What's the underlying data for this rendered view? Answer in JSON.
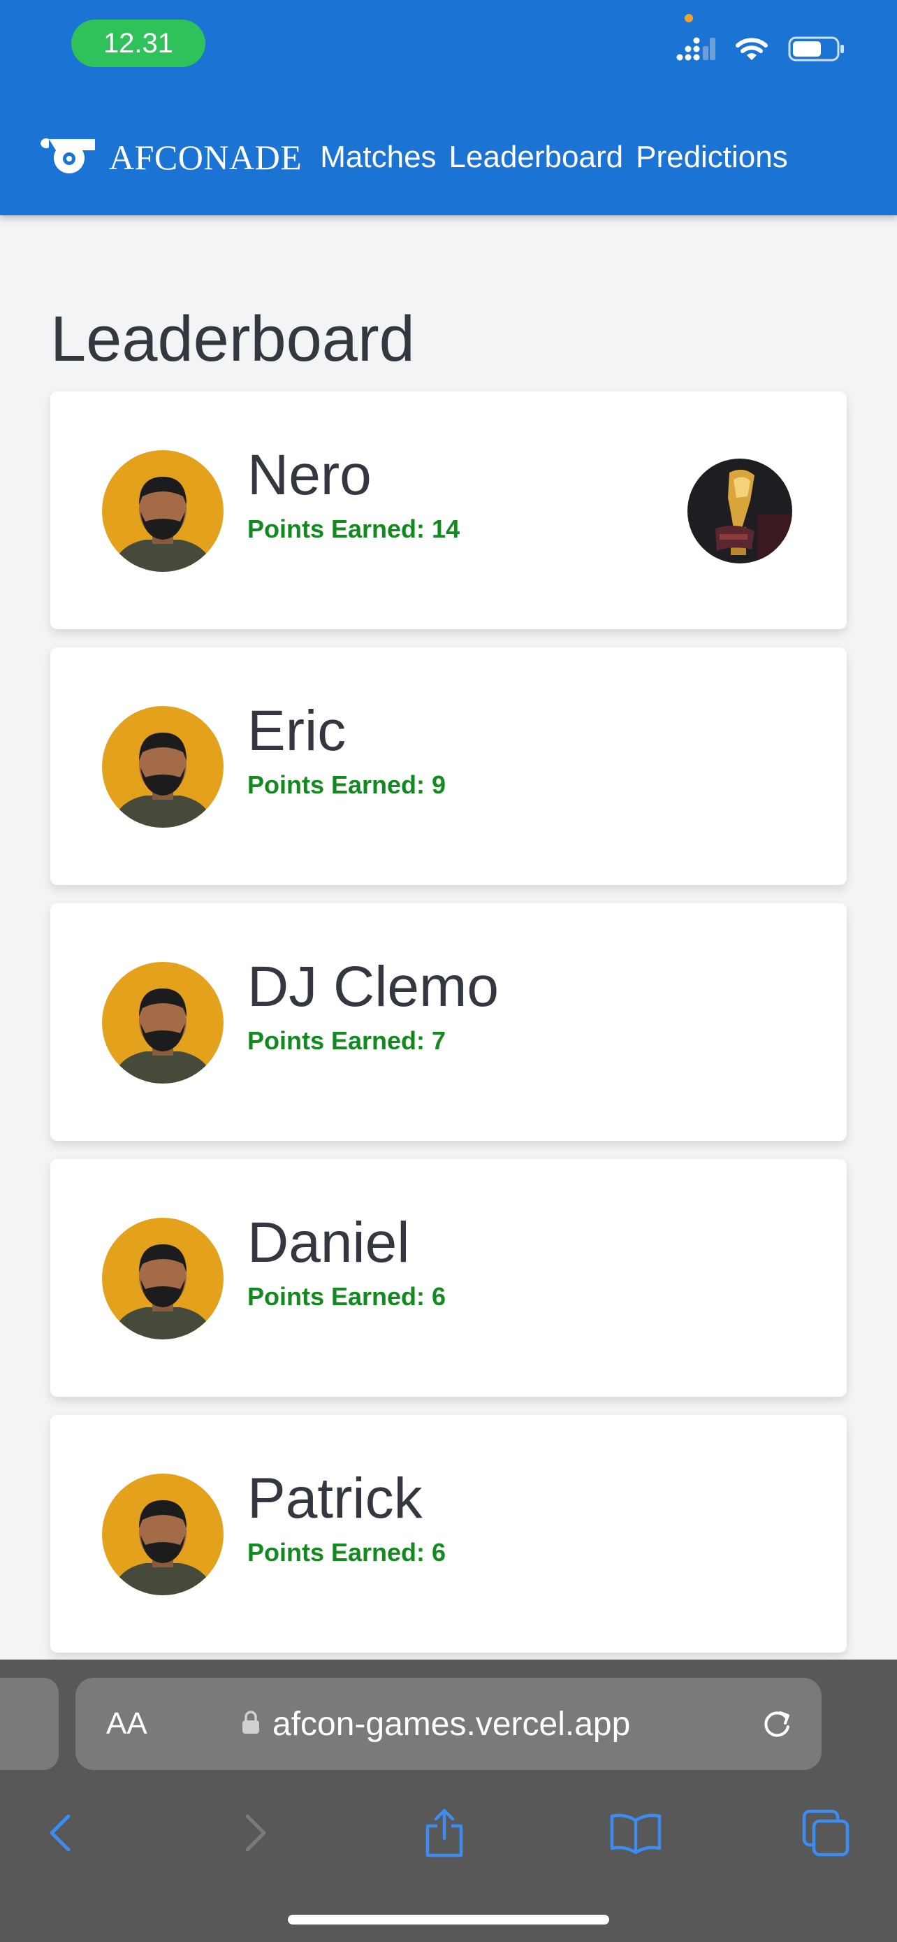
{
  "status_bar": {
    "time": "12.31",
    "icons": [
      "signal-icon",
      "wifi-icon",
      "battery-icon"
    ]
  },
  "nav": {
    "brand": "AFCONADE",
    "logo_icon": "whistle-icon",
    "links": [
      "Matches",
      "Leaderboard",
      "Predictions"
    ]
  },
  "page": {
    "title": "Leaderboard",
    "points_label": "Points Earned: "
  },
  "leaderboard": [
    {
      "name": "Nero",
      "points": "14",
      "badge": "trophy-avatar"
    },
    {
      "name": "Eric",
      "points": "9"
    },
    {
      "name": "DJ Clemo",
      "points": "7"
    },
    {
      "name": "Daniel",
      "points": "6"
    },
    {
      "name": "Patrick",
      "points": "6"
    }
  ],
  "browser": {
    "text_size_label": "AA",
    "url": "afcon-games.vercel.app",
    "toolbar": [
      "back-icon",
      "forward-icon",
      "share-icon",
      "bookmarks-icon",
      "tabs-icon"
    ]
  },
  "colors": {
    "header": "#1b74d4",
    "points": "#138a1f",
    "avatar_bg": "#e4a11b",
    "page_bg": "#f3f4f6"
  }
}
